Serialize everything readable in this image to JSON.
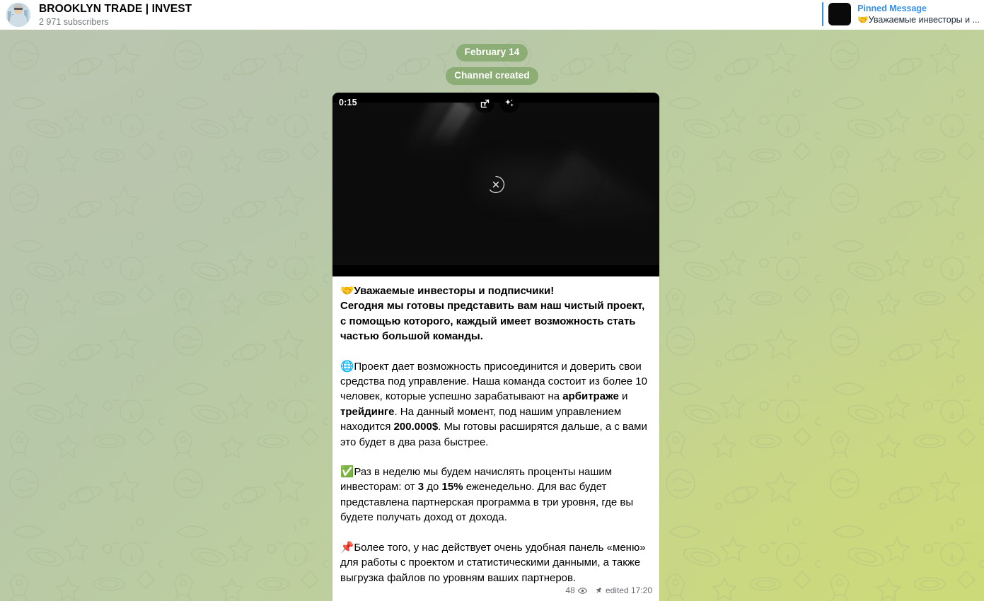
{
  "header": {
    "channel_title": "BROOKLYN TRADE | INVEST",
    "subscribers": "2 971 subscribers",
    "avatar_icon": "user-avatar",
    "pinned": {
      "label": "Pinned Message",
      "preview": "🤝Уважаемые инвесторы и ...",
      "accent_color": "#3390ec"
    }
  },
  "service_messages": [
    {
      "text": "February 14"
    },
    {
      "text": "Channel created"
    }
  ],
  "message": {
    "video": {
      "duration": "0:15",
      "share_icon": "share-external-icon",
      "sparkle_icon": "sparkles-icon",
      "cancel_icon": "cancel-download-icon"
    },
    "paragraphs": [
      {
        "emoji": "🤝",
        "emoji_name": "handshake-emoji",
        "bold_all": true,
        "runs": [
          {
            "text": "Уважаемые инвесторы и подписчики!",
            "bold": true
          },
          {
            "text": "\n",
            "bold": true
          },
          {
            "text": "Сегодня мы готовы представить вам наш чистый проект, с помощью которого, каждый имеет возможность стать частью большой команды.",
            "bold": true
          }
        ]
      },
      {
        "emoji": "🌐",
        "emoji_name": "globe-emoji",
        "bold_all": false,
        "runs": [
          {
            "text": "Проект дает возможность присоединится и доверить свои средства под управление. Наша команда состоит из более 10 человек, которые успешно зарабатывают на ",
            "bold": false
          },
          {
            "text": "арбитраже",
            "bold": true
          },
          {
            "text": " и ",
            "bold": false
          },
          {
            "text": "трейдинге",
            "bold": true
          },
          {
            "text": ". На данный момент, под нашим управлением находится ",
            "bold": false
          },
          {
            "text": "200.000$",
            "bold": true
          },
          {
            "text": ". Мы готовы расширятся дальше, а с вами это будет в два раза быстрее.",
            "bold": false
          }
        ]
      },
      {
        "emoji": "✅",
        "emoji_name": "check-mark-emoji",
        "bold_all": false,
        "runs": [
          {
            "text": "Раз в неделю мы будем начислять проценты нашим инвесторам: от ",
            "bold": false
          },
          {
            "text": "3",
            "bold": true
          },
          {
            "text": " до ",
            "bold": false
          },
          {
            "text": "15%",
            "bold": true
          },
          {
            "text": " еженедельно. Для вас будет представлена партнерская программа в три уровня, где вы будете получать доход от дохода.",
            "bold": false
          }
        ]
      },
      {
        "emoji": "📌",
        "emoji_name": "pushpin-emoji",
        "bold_all": false,
        "runs": [
          {
            "text": "Более того, у нас действует очень удобная панель «меню» для работы с проектом и статистическими данными, а также выгрузка файлов по уровням ваших партнеров.",
            "bold": false
          }
        ]
      }
    ],
    "meta": {
      "views": "48",
      "views_icon": "eye-icon",
      "pin_icon": "pin-icon",
      "edited": "edited 17:20"
    }
  },
  "theme": {
    "background_gradient_start": "#b9c6ad",
    "background_gradient_end": "#cdd97e",
    "service_badge_bg": "rgba(113,158,87,0.62)",
    "bubble_bg": "#ffffff",
    "link_blue": "#3390ec"
  }
}
